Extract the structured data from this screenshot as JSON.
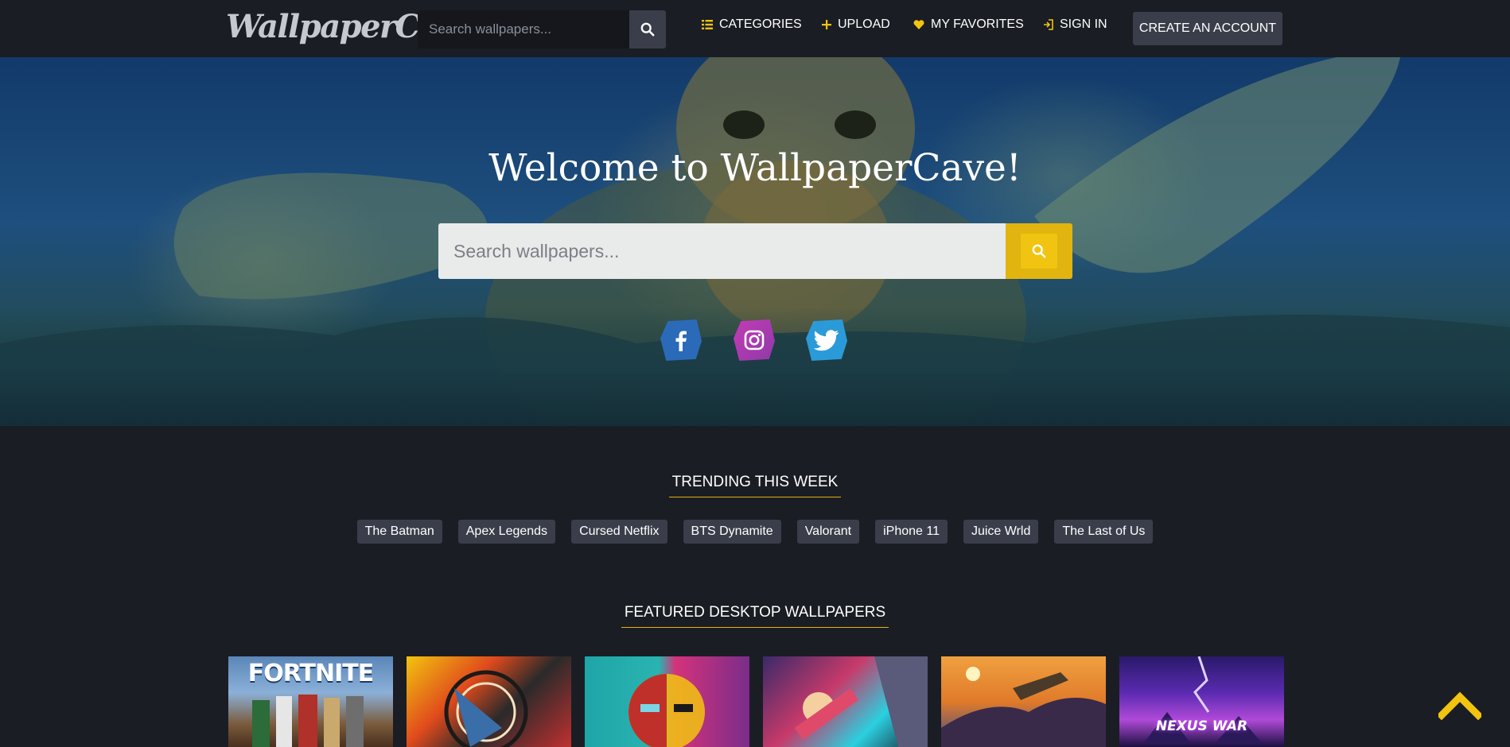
{
  "nav": {
    "logo": "WallpaperCave",
    "search_placeholder": "Search wallpapers...",
    "links": {
      "categories": "CATEGORIES",
      "upload": "UPLOAD",
      "favorites": "MY FAVORITES",
      "sign_in": "SIGN IN"
    },
    "create_account": "CREATE AN ACCOUNT"
  },
  "hero": {
    "title": "Welcome to WallpaperCave!",
    "search_placeholder": "Search wallpapers...",
    "social": [
      "facebook-icon",
      "instagram-icon",
      "twitter-icon"
    ]
  },
  "trending": {
    "title": "TRENDING THIS WEEK",
    "tags": [
      "The Batman",
      "Apex Legends",
      "Cursed Netflix",
      "BTS Dynamite",
      "Valorant",
      "iPhone 11",
      "Juice Wrld",
      "The Last of Us"
    ]
  },
  "featured": {
    "title": "FEATURED DESKTOP WALLPAPERS",
    "thumbs": [
      {
        "label": "FORTNITE"
      },
      {
        "label": ""
      },
      {
        "label": ""
      },
      {
        "label": ""
      },
      {
        "label": ""
      },
      {
        "label": "NEXUS WAR"
      }
    ]
  },
  "colors": {
    "accent": "#f2c40f",
    "background": "#1b1d24",
    "button": "#3a3e4a"
  }
}
